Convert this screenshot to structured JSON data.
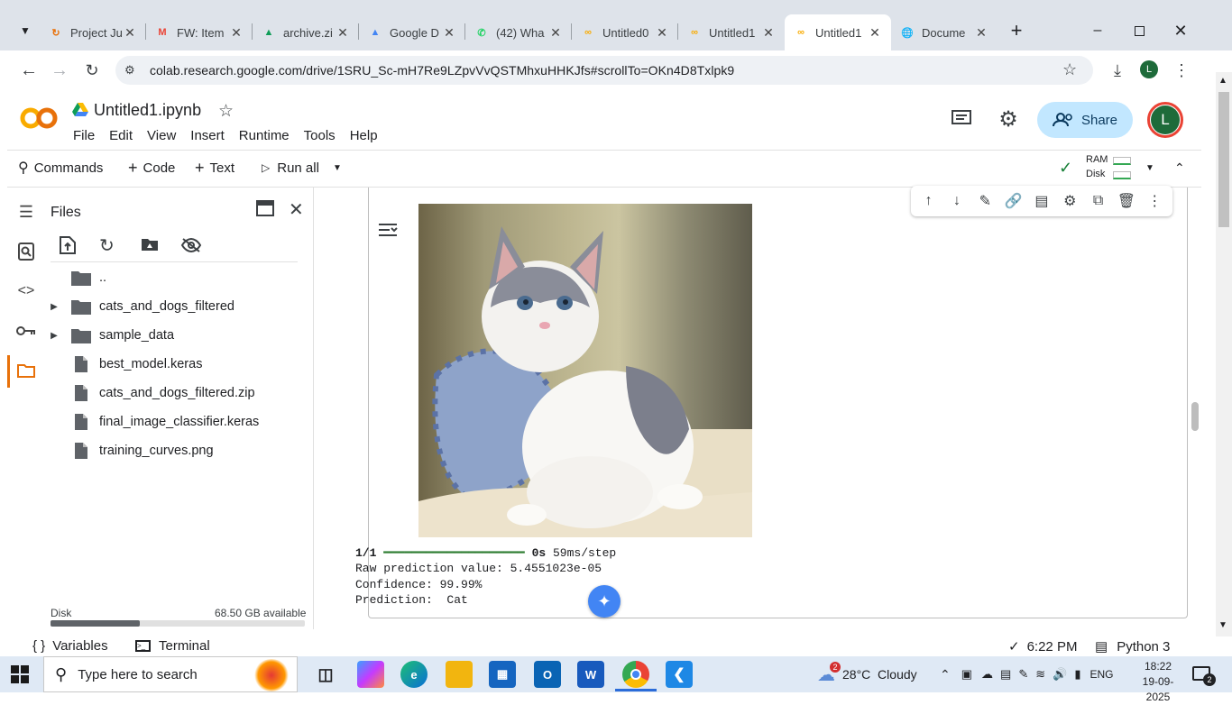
{
  "browser": {
    "tabs": [
      {
        "title": "Project Ju",
        "icon": "refresh-ring-icon",
        "color": "#e8710a"
      },
      {
        "title": "FW: Item",
        "icon": "gmail-icon",
        "color": "#ea4335"
      },
      {
        "title": "archive.zi",
        "icon": "drive-icon",
        "color": "#0f9d58"
      },
      {
        "title": "Google D",
        "icon": "drive-icon",
        "color": "#4285f4"
      },
      {
        "title": "(42) Wha",
        "icon": "whatsapp-icon",
        "color": "#25d366"
      },
      {
        "title": "Untitled0",
        "icon": "colab-icon",
        "color": "#f9ab00"
      },
      {
        "title": "Untitled1",
        "icon": "colab-icon",
        "color": "#f9ab00"
      },
      {
        "title": "Untitled1",
        "icon": "colab-icon",
        "color": "#f9ab00",
        "active": true
      },
      {
        "title": "Docume",
        "icon": "globe-icon",
        "color": "#5f6368"
      }
    ],
    "new_tab": "+",
    "url": "colab.research.google.com/drive/1SRU_Sc-mH7Re9LZpvVvQSTMhxuHHKJfs#scrollTo=OKn4D8Txlpk9",
    "profile_initial": "L"
  },
  "colab": {
    "notebook_title": "Untitled1.ipynb",
    "menu": [
      "File",
      "Edit",
      "View",
      "Insert",
      "Runtime",
      "Tools",
      "Help"
    ],
    "share_label": "Share",
    "avatar_initial": "L",
    "toolbar": {
      "commands": "Commands",
      "code": "Code",
      "text": "Text",
      "run_all": "Run all",
      "ram": "RAM",
      "disk": "Disk"
    },
    "files": {
      "title": "Files",
      "items": [
        {
          "name": "..",
          "type": "folder",
          "expandable": false
        },
        {
          "name": "cats_and_dogs_filtered",
          "type": "folder",
          "expandable": true
        },
        {
          "name": "sample_data",
          "type": "folder",
          "expandable": true
        },
        {
          "name": "best_model.keras",
          "type": "file"
        },
        {
          "name": "cats_and_dogs_filtered.zip",
          "type": "file"
        },
        {
          "name": "final_image_classifier.keras",
          "type": "file"
        },
        {
          "name": "training_curves.png",
          "type": "file"
        }
      ],
      "disk_label": "Disk",
      "disk_available": "68.50 GB available",
      "disk_usage_fraction": 0.35
    },
    "output": {
      "line1_prefix": "1/1",
      "line1_bar": "━━━━━━━━━━━━━━━━━━━━",
      "line1_time": "0s",
      "line1_step": " 59ms/step",
      "line2": "Raw prediction value: 5.4551023e-05",
      "line3": "Confidence: 99.99%",
      "line4": "Prediction:  Cat"
    },
    "status": {
      "variables": "Variables",
      "terminal": "Terminal",
      "time": "6:22 PM",
      "runtime": "Python 3"
    }
  },
  "taskbar": {
    "search_placeholder": "Type here to search",
    "weather_badge": "2",
    "weather": "28°C  Cloudy",
    "language": "ENG",
    "clock_time": "18:22",
    "clock_date": "19-09-2025",
    "notification_count": "2"
  }
}
